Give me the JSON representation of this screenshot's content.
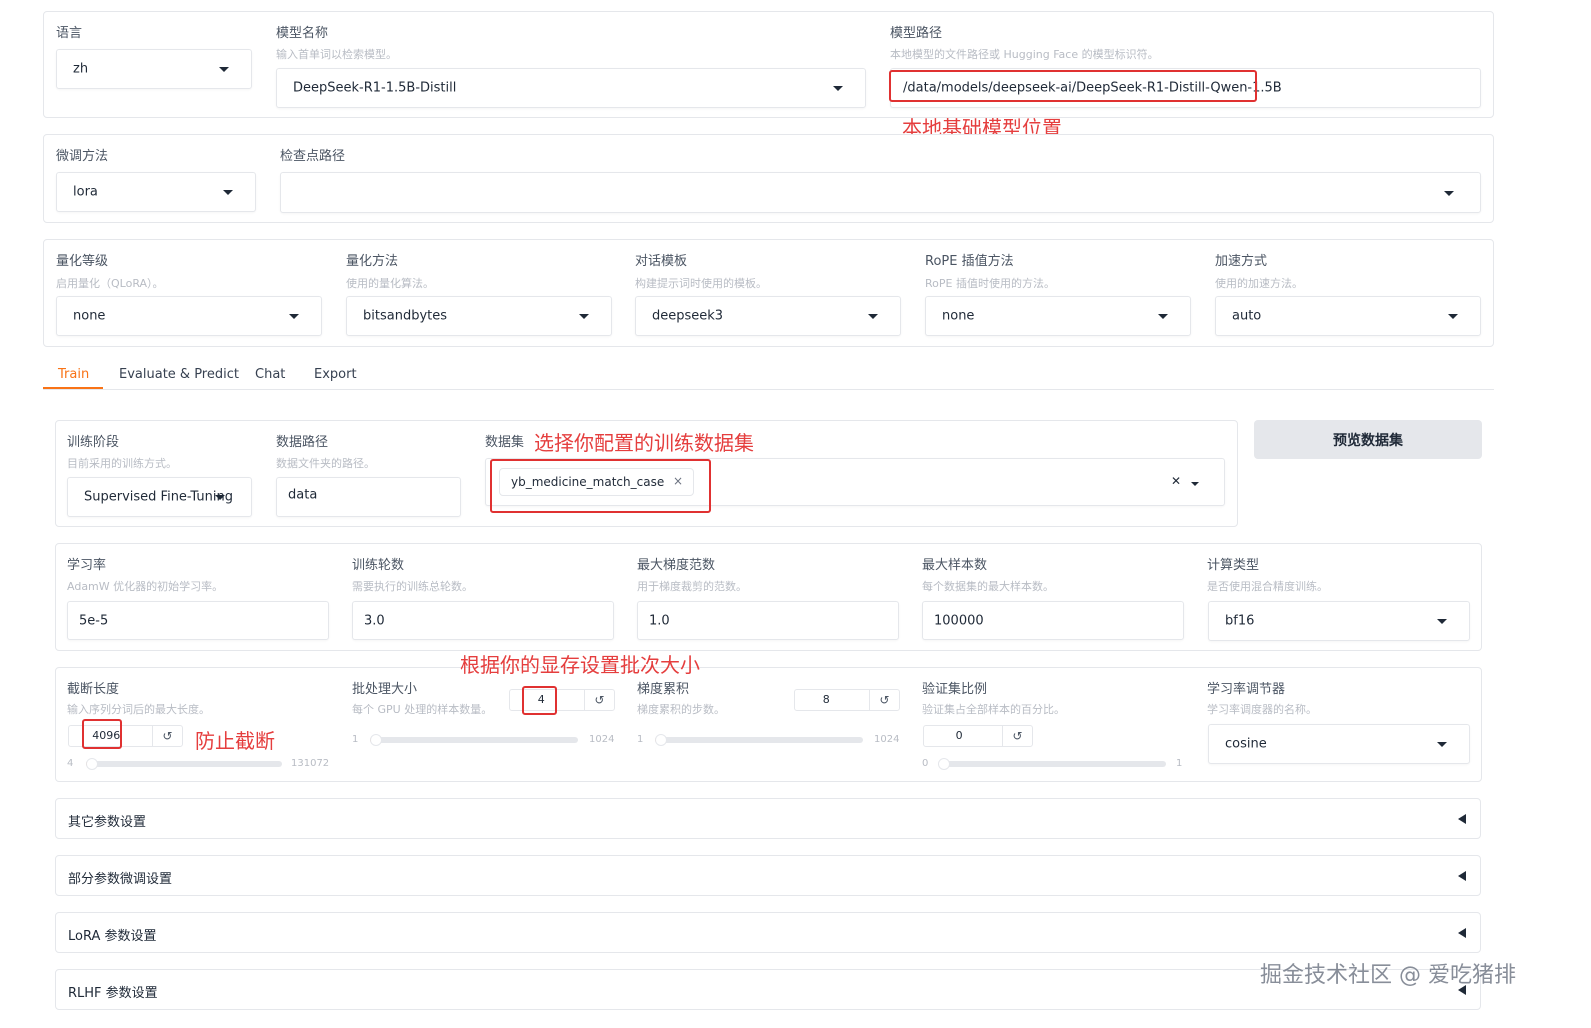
{
  "model_row": {
    "lang_label": "语言",
    "lang_value": "zh",
    "name_label": "模型名称",
    "name_hint": "输入首单词以检索模型。",
    "name_value": "DeepSeek-R1-1.5B-Distill",
    "path_label": "模型路径",
    "path_hint": "本地模型的文件路径或 Hugging Face 的模型标识符。",
    "path_value": "/data/models/deepseek-ai/DeepSeek-R1-Distill-Qwen-1.5B"
  },
  "finetune_row": {
    "method_label": "微调方法",
    "method_value": "lora",
    "ckpt_label": "检查点路径",
    "ckpt_value": ""
  },
  "quant_row": {
    "qbit_label": "量化等级",
    "qbit_hint": "启用量化（QLoRA）。",
    "qbit_value": "none",
    "qmethod_label": "量化方法",
    "qmethod_hint": "使用的量化算法。",
    "qmethod_value": "bitsandbytes",
    "template_label": "对话模板",
    "template_hint": "构建提示词时使用的模板。",
    "template_value": "deepseek3",
    "rope_label": "RoPE 插值方法",
    "rope_hint": "RoPE 插值时使用的方法。",
    "rope_value": "none",
    "booster_label": "加速方式",
    "booster_hint": "使用的加速方法。",
    "booster_value": "auto"
  },
  "tabs": [
    "Train",
    "Evaluate & Predict",
    "Chat",
    "Export"
  ],
  "train": {
    "stage_label": "训练阶段",
    "stage_hint": "目前采用的训练方式。",
    "stage_value": "Supervised Fine-Tuning",
    "dir_label": "数据路径",
    "dir_hint": "数据文件夹的路径。",
    "dir_value": "data",
    "dataset_label": "数据集",
    "dataset_chip": "yb_medicine_match_case",
    "chip_close": "×",
    "clear": "✕",
    "preview_button": "预览数据集"
  },
  "hparams": {
    "lr_label": "学习率",
    "lr_hint": "AdamW 优化器的初始学习率。",
    "lr_value": "5e-5",
    "epochs_label": "训练轮数",
    "epochs_hint": "需要执行的训练总轮数。",
    "epochs_value": "3.0",
    "grad_label": "最大梯度范数",
    "grad_hint": "用于梯度裁剪的范数。",
    "grad_value": "1.0",
    "samples_label": "最大样本数",
    "samples_hint": "每个数据集的最大样本数。",
    "samples_value": "100000",
    "compute_label": "计算类型",
    "compute_hint": "是否使用混合精度训练。",
    "compute_value": "bf16"
  },
  "sliders": {
    "cutoff_label": "截断长度",
    "cutoff_hint": "输入序列分词后的最大长度。",
    "cutoff_value": "4096",
    "cutoff_min": "4",
    "cutoff_max": "131072",
    "cutoff_fraction": 0.03,
    "batch_label": "批处理大小",
    "batch_hint": "每个 GPU 处理的样本数量。",
    "batch_value": "4",
    "batch_min": "1",
    "batch_max": "1024",
    "batch_fraction": 0.003,
    "accum_label": "梯度累积",
    "accum_hint": "梯度累积的步数。",
    "accum_value": "8",
    "accum_min": "1",
    "accum_max": "1024",
    "accum_fraction": 0.007,
    "val_label": "验证集比例",
    "val_hint": "验证集占全部样本的百分比。",
    "val_value": "0",
    "val_min": "0",
    "val_max": "1",
    "val_fraction": 0.0,
    "sched_label": "学习率调节器",
    "sched_hint": "学习率调度器的名称。",
    "sched_value": "cosine",
    "reset_icon": "↺"
  },
  "accordions": [
    "其它参数设置",
    "部分参数微调设置",
    "LoRA 参数设置",
    "RLHF 参数设置"
  ],
  "annotations": {
    "model_path": "本地基础模型位置",
    "dataset": "选择你配置的训练数据集",
    "batch": "根据你的显存设置批次大小",
    "cutoff": "防止截断"
  },
  "watermark": "掘金技术社区 @ 爱吃猪排",
  "colors": {
    "accent": "#f97316",
    "annotation": "#e53e3e",
    "border": "#e5e7eb"
  }
}
